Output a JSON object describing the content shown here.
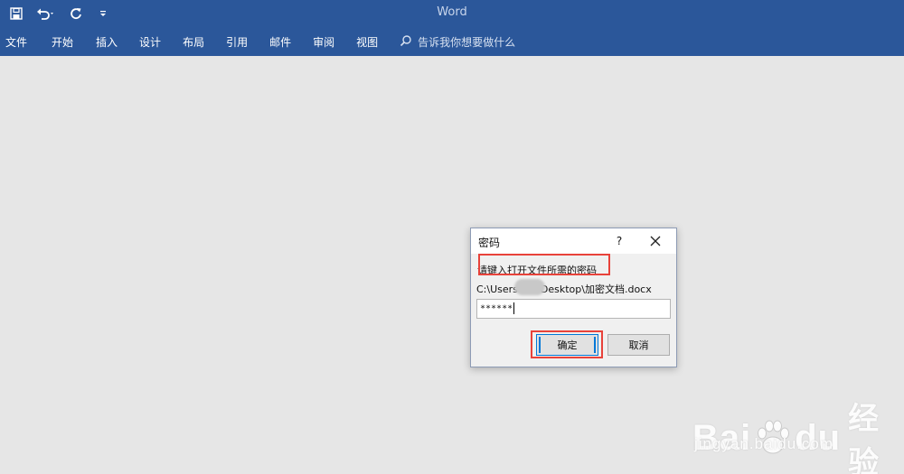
{
  "window": {
    "title": "Word"
  },
  "ribbon": {
    "tabs": [
      {
        "label": "文件"
      },
      {
        "label": "开始"
      },
      {
        "label": "插入"
      },
      {
        "label": "设计"
      },
      {
        "label": "布局"
      },
      {
        "label": "引用"
      },
      {
        "label": "邮件"
      },
      {
        "label": "审阅"
      },
      {
        "label": "视图"
      }
    ],
    "tell_me": "告诉我你想要做什么"
  },
  "dialog": {
    "title": "密码",
    "help_label": "?",
    "prompt": "请键入打开文件所需的密码",
    "path_prefix": "C:\\Users",
    "path_suffix": "Desktop\\加密文档.docx",
    "password_value": "******",
    "ok_label": "确定",
    "cancel_label": "取消"
  },
  "watermark": {
    "brand_left": "Bai",
    "brand_right": "du",
    "brand_cn": "经验",
    "url": "jingyan.baidu.com"
  },
  "colors": {
    "ribbon_blue": "#2b579a",
    "highlight_red": "#e8423a",
    "focus_blue": "#0078d7"
  }
}
